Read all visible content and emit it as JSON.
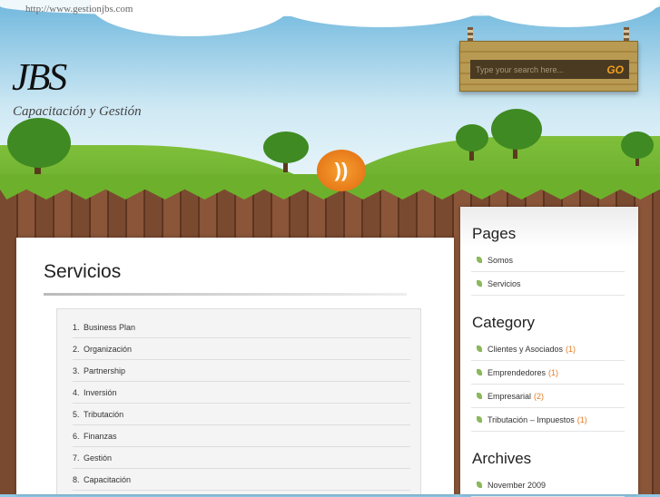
{
  "browser": {
    "url": "http://www.gestionjbs.com"
  },
  "header": {
    "logo": "JBS",
    "tagline": "Capacitación y Gestión"
  },
  "search": {
    "placeholder": "Type your search here...",
    "button": "GO"
  },
  "main": {
    "title": "Servicios",
    "items": [
      {
        "n": "1.",
        "label": "Business Plan"
      },
      {
        "n": "2.",
        "label": "Organización"
      },
      {
        "n": "3.",
        "label": "Partnership"
      },
      {
        "n": "4.",
        "label": "Inversión"
      },
      {
        "n": "5.",
        "label": "Tributación"
      },
      {
        "n": "6.",
        "label": "Finanzas"
      },
      {
        "n": "7.",
        "label": "Gestión"
      },
      {
        "n": "8.",
        "label": "Capacitación"
      }
    ]
  },
  "sidebar": {
    "pages": {
      "title": "Pages",
      "items": [
        "Somos",
        "Servicios"
      ]
    },
    "category": {
      "title": "Category",
      "items": [
        {
          "label": "Clientes y Asociados",
          "count": "(1)"
        },
        {
          "label": "Emprendedores",
          "count": "(1)"
        },
        {
          "label": "Empresarial",
          "count": "(2)"
        },
        {
          "label": "Tributación – Impuestos",
          "count": "(1)"
        }
      ]
    },
    "archives": {
      "title": "Archives",
      "items": [
        "November 2009"
      ]
    }
  },
  "colors": {
    "accent": "#e87a20",
    "leaf": "#8cb85a"
  }
}
